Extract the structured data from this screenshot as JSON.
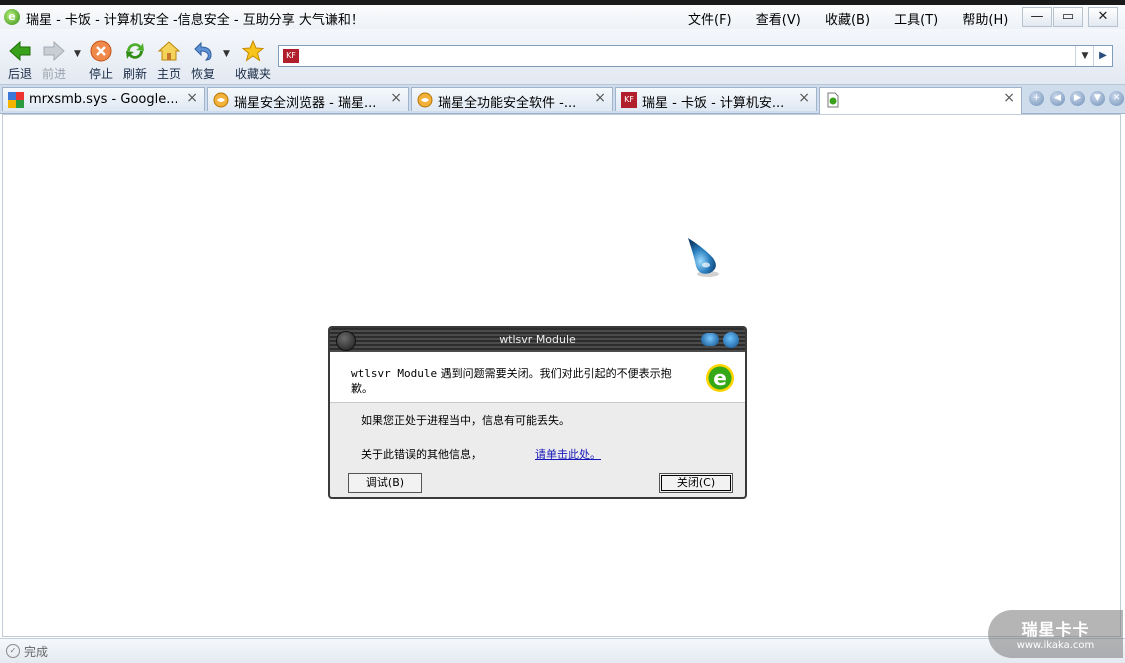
{
  "window": {
    "title": "瑞星 - 卡饭 - 计算机安全 -信息安全 - 互助分享 大气谦和！",
    "menu": [
      "文件(F)",
      "查看(V)",
      "收藏(B)",
      "工具(T)",
      "帮助(H)"
    ]
  },
  "toolbar": {
    "back": "后退",
    "forward": "前进",
    "stop": "停止",
    "refresh": "刷新",
    "home": "主页",
    "restore": "恢复",
    "favorites": "收藏夹"
  },
  "address": {
    "value": ""
  },
  "tabs": [
    {
      "label": "mrxsmb.sys - Google..."
    },
    {
      "label": "瑞星安全浏览器 - 瑞星..."
    },
    {
      "label": "瑞星全功能安全软件 -..."
    },
    {
      "label": "瑞星 - 卡饭 - 计算机安..."
    },
    {
      "label": ""
    }
  ],
  "dialog": {
    "title": "wtlsvr Module",
    "module_name": "wtlsvr Module",
    "message_rest": " 遇到问题需要关闭。我们对此引起的不便表示抱歉。",
    "line1": "如果您正处于进程当中，信息有可能丢失。",
    "line2": "关于此错误的其他信息，",
    "link": "请单击此处。",
    "debug_button": "调试(B)",
    "close_button": "关闭(C)"
  },
  "status": {
    "text": "完成"
  },
  "watermark": {
    "line1": "瑞星卡卡",
    "line2": "www.ikaka.com"
  },
  "colors": {
    "tab_bar": "#cfdcec",
    "dialog_title": "#2c2c2c",
    "link": "#1515b8"
  }
}
